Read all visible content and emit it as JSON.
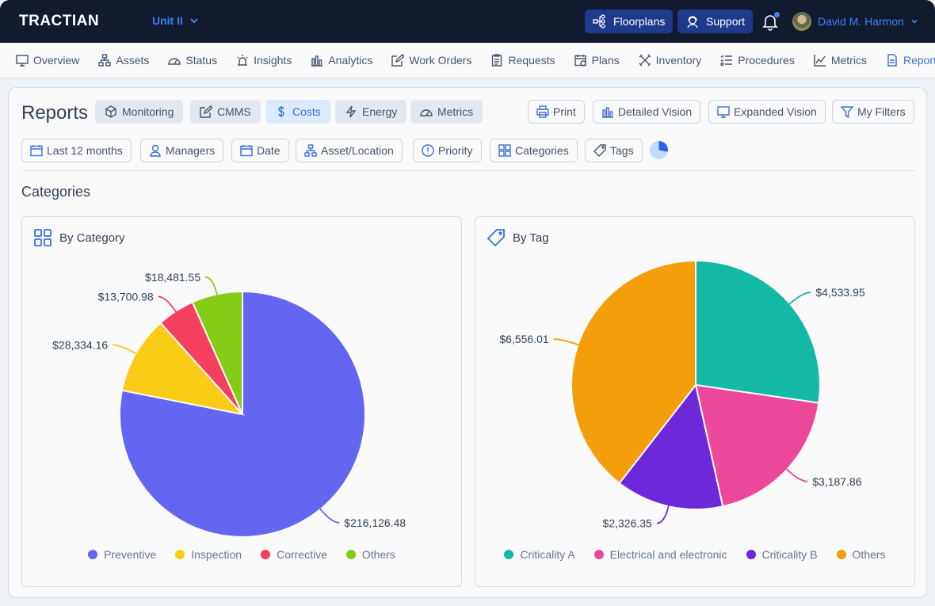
{
  "topbar": {
    "logo": "TRACTIAN",
    "unit": "Unit II",
    "floorplans": "Floorplans",
    "support": "Support",
    "user_name": "David M. Harmon"
  },
  "nav": {
    "items": [
      {
        "label": "Overview",
        "icon": "monitor-icon"
      },
      {
        "label": "Assets",
        "icon": "hierarchy-icon"
      },
      {
        "label": "Status",
        "icon": "gauge-icon"
      },
      {
        "label": "Insights",
        "icon": "alarm-icon"
      },
      {
        "label": "Analytics",
        "icon": "bar-chart-icon"
      },
      {
        "label": "Work Orders",
        "icon": "edit-icon"
      },
      {
        "label": "Requests",
        "icon": "clipboard-icon"
      },
      {
        "label": "Plans",
        "icon": "calendar-clock-icon"
      },
      {
        "label": "Inventory",
        "icon": "tools-icon"
      },
      {
        "label": "Procedures",
        "icon": "checklist-icon"
      },
      {
        "label": "Metrics",
        "icon": "line-chart-icon"
      },
      {
        "label": "Reports",
        "icon": "document-icon",
        "active": true
      }
    ]
  },
  "header": {
    "title": "Reports",
    "tabs": [
      {
        "label": "Monitoring",
        "icon": "cube-icon"
      },
      {
        "label": "CMMS",
        "icon": "edit-icon"
      },
      {
        "label": "Costs",
        "icon": "dollar-icon",
        "active": true
      },
      {
        "label": "Energy",
        "icon": "lightning-icon"
      },
      {
        "label": "Metrics",
        "icon": "gauge-icon"
      }
    ],
    "actions": {
      "print": "Print",
      "detailed": "Detailed Vision",
      "expanded": "Expanded Vision",
      "filters": "My Filters"
    }
  },
  "filters": [
    {
      "label": "Last 12 months",
      "icon": "calendar-icon"
    },
    {
      "label": "Managers",
      "icon": "user-icon"
    },
    {
      "label": "Date",
      "icon": "calendar-icon"
    },
    {
      "label": "Asset/Location",
      "icon": "hierarchy-icon"
    },
    {
      "label": "Priority",
      "icon": "alert-circle-icon"
    },
    {
      "label": "Categories",
      "icon": "grid-icon"
    },
    {
      "label": "Tags",
      "icon": "tag-icon"
    }
  ],
  "loading_progress": 0.28,
  "section_title": "Categories",
  "chart_data": [
    {
      "type": "pie",
      "title": "By Category",
      "categories": [
        "Preventive",
        "Inspection",
        "Corrective",
        "Others"
      ],
      "values": [
        216126.48,
        28334.16,
        13700.98,
        18481.55
      ],
      "labels": [
        "$216,126.48",
        "$28,334.16",
        "$13,700.98",
        "$18,481.55"
      ],
      "colors": [
        "#6366f1",
        "#facc15",
        "#f43f5e",
        "#84cc16"
      ],
      "legend": "bottom"
    },
    {
      "type": "pie",
      "title": "By Tag",
      "categories": [
        "Criticality A",
        "Electrical and electronic",
        "Criticality B",
        "Others"
      ],
      "values": [
        4533.95,
        3187.86,
        2326.35,
        6556.01
      ],
      "labels": [
        "$4,533.95",
        "$3,187.86",
        "$2,326.35",
        "$6,556.01"
      ],
      "colors": [
        "#14b8a6",
        "#ec4899",
        "#6d28d9",
        "#f59e0b"
      ],
      "legend": "bottom"
    }
  ]
}
